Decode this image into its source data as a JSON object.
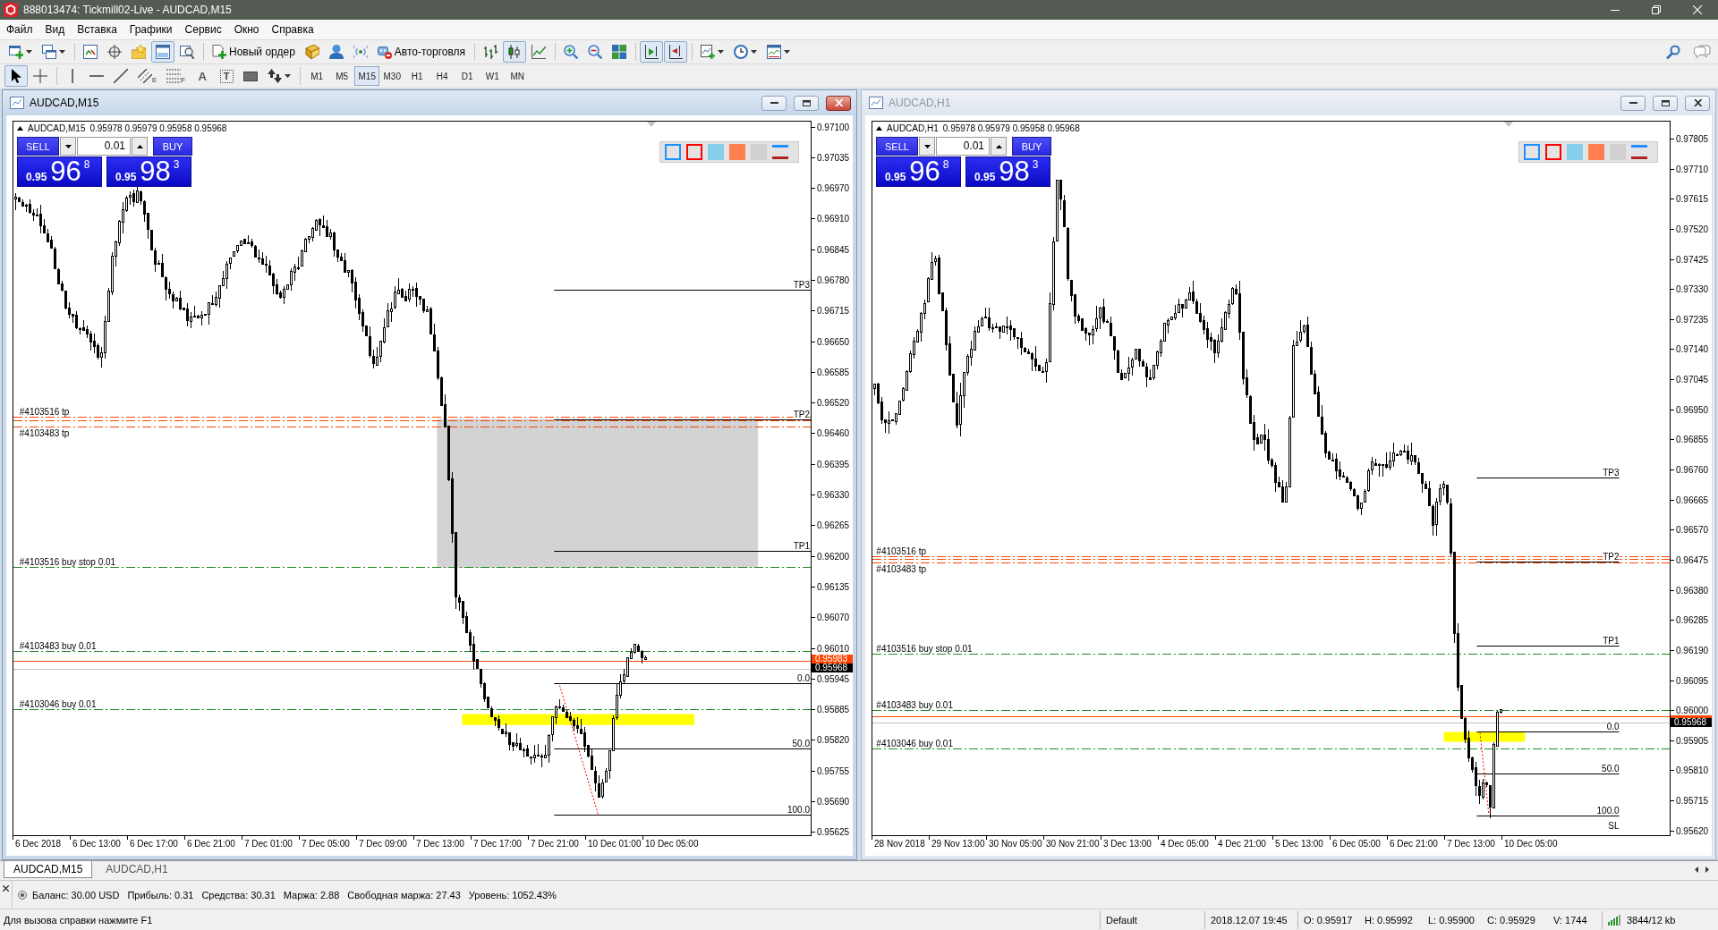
{
  "window": {
    "title": "888013474: Tickmill02-Live - AUDCAD,M15"
  },
  "menu": [
    "Файл",
    "Вид",
    "Вставка",
    "Графики",
    "Сервис",
    "Окно",
    "Справка"
  ],
  "toolbar": [
    [
      {
        "kind": "menu",
        "pressed": false
      },
      {
        "kind": "menu",
        "pressed": false
      }
    ],
    [
      {
        "kind": "icon",
        "pressed": false
      },
      {
        "kind": "icon",
        "pressed": false
      },
      {
        "kind": "icon",
        "pressed": false
      },
      {
        "kind": "icon",
        "pressed": true
      },
      {
        "kind": "icon",
        "pressed": false
      }
    ],
    [
      {
        "kind": "icontext",
        "label": "Новый ордер",
        "pressed": false
      },
      {
        "kind": "icon",
        "pressed": false
      },
      {
        "kind": "icon",
        "pressed": false
      },
      {
        "kind": "icon",
        "pressed": false
      },
      {
        "kind": "icontext",
        "label": "Авто-торговля",
        "pressed": false
      }
    ],
    [
      {
        "kind": "icon",
        "pressed": false
      },
      {
        "kind": "icon",
        "pressed": true
      },
      {
        "kind": "icon",
        "pressed": false
      }
    ],
    [
      {
        "kind": "icon",
        "pressed": false
      },
      {
        "kind": "icon",
        "pressed": false
      },
      {
        "kind": "icon",
        "pressed": false
      }
    ],
    [
      {
        "kind": "icon",
        "pressed": true
      },
      {
        "kind": "icon",
        "pressed": true
      }
    ],
    [
      {
        "kind": "menu",
        "pressed": false
      },
      {
        "kind": "menu",
        "pressed": false
      },
      {
        "kind": "menu",
        "pressed": false
      }
    ]
  ],
  "drawing_tools": [
    [
      {
        "kind": "icon",
        "pressed": true
      },
      {
        "kind": "icon",
        "pressed": false
      }
    ],
    [
      {
        "kind": "icon",
        "pressed": false
      },
      {
        "kind": "icon",
        "pressed": false
      },
      {
        "kind": "icon",
        "pressed": false
      },
      {
        "kind": "icon",
        "pressed": false,
        "sub": "E"
      },
      {
        "kind": "icon",
        "pressed": false,
        "sub": "F"
      },
      {
        "kind": "text",
        "label": "A",
        "pressed": false
      },
      {
        "kind": "framed",
        "label": "T",
        "pressed": false
      },
      {
        "kind": "icon",
        "pressed": false
      },
      {
        "kind": "menu",
        "pressed": false
      }
    ]
  ],
  "timeframes": [
    {
      "label": "M1",
      "selected": false
    },
    {
      "label": "M5",
      "selected": false
    },
    {
      "label": "M15",
      "selected": true
    },
    {
      "label": "M30",
      "selected": false
    },
    {
      "label": "H1",
      "selected": false
    },
    {
      "label": "H4",
      "selected": false
    },
    {
      "label": "D1",
      "selected": false
    },
    {
      "label": "W1",
      "selected": false
    },
    {
      "label": "MN",
      "selected": false
    }
  ],
  "charts": [
    {
      "title": "AUDCAD,M15",
      "active": true,
      "symbol": "AUDCAD,M15",
      "quote": "0.95978 0.95979 0.95958 0.95968",
      "trade_panel": {
        "sell": "SELL",
        "buy": "BUY",
        "lot": "0.01",
        "bid": {
          "prefix": "0.95",
          "big": "96",
          "sup": "8"
        },
        "ask": {
          "prefix": "0.95",
          "big": "98",
          "sup": "3"
        }
      },
      "order_lines": [
        {
          "kind": "tp",
          "label": "#4103516 tp"
        },
        {
          "kind": "tp",
          "label": "#4103483 tp"
        },
        {
          "kind": "order",
          "label": "#4103516 buy stop 0.01"
        },
        {
          "kind": "order",
          "label": "#4103483 buy 0.01"
        },
        {
          "kind": "order",
          "label": "#4103046 buy 0.01"
        }
      ],
      "targets": [
        "TP3",
        "TP2",
        "TP1"
      ],
      "fibo": [
        "0.0",
        "50.0",
        "100.0"
      ],
      "price_axis": [
        "0.97100",
        "0.97035",
        "0.96970",
        "0.96910",
        "0.96845",
        "0.96780",
        "0.96715",
        "0.96650",
        "0.96585",
        "0.96520",
        "0.96460",
        "0.96395",
        "0.96330",
        "0.96265",
        "0.96200",
        "0.96135",
        "0.96070",
        "0.96010",
        "0.95945",
        "0.95885",
        "0.95820",
        "0.95755",
        "0.95690",
        "0.95625"
      ],
      "price_tags": [
        {
          "kind": "ask",
          "label": "0.95983"
        },
        {
          "kind": "bid",
          "label": "0.95968"
        }
      ],
      "time_axis": [
        "6 Dec 2018",
        "6 Dec 13:00",
        "6 Dec 17:00",
        "6 Dec 21:00",
        "7 Dec 01:00",
        "7 Dec 05:00",
        "7 Dec 09:00",
        "7 Dec 13:00",
        "7 Dec 17:00",
        "7 Dec 21:00",
        "10 Dec 01:00",
        "10 Dec 05:00"
      ]
    },
    {
      "title": "AUDCAD,H1",
      "active": false,
      "symbol": "AUDCAD,H1",
      "quote": "0.95978 0.95979 0.95958 0.95968",
      "trade_panel": {
        "sell": "SELL",
        "buy": "BUY",
        "lot": "0.01",
        "bid": {
          "prefix": "0.95",
          "big": "96",
          "sup": "8"
        },
        "ask": {
          "prefix": "0.95",
          "big": "98",
          "sup": "3"
        }
      },
      "order_lines": [
        {
          "kind": "tp",
          "label": "#4103516 tp"
        },
        {
          "kind": "tp",
          "label": "#4103483 tp"
        },
        {
          "kind": "order",
          "label": "#4103516 buy stop 0.01"
        },
        {
          "kind": "order",
          "label": "#4103483 buy 0.01"
        },
        {
          "kind": "order",
          "label": "#4103046 buy 0.01"
        }
      ],
      "targets": [
        "TP3",
        "TP2",
        "TP1"
      ],
      "fibo": [
        "0.0",
        "50.0",
        "100.0",
        "SL"
      ],
      "price_axis": [
        "0.97805",
        "0.97710",
        "0.97615",
        "0.97520",
        "0.97425",
        "0.97330",
        "0.97235",
        "0.97140",
        "0.97045",
        "0.96950",
        "0.96855",
        "0.96760",
        "0.96665",
        "0.96570",
        "0.96475",
        "0.96380",
        "0.96285",
        "0.96190",
        "0.96095",
        "0.96000",
        "0.95905",
        "0.95810",
        "0.95715",
        "0.95620"
      ],
      "price_tags": [
        {
          "kind": "ask"
        },
        {
          "kind": "bid",
          "label": "0.95968"
        }
      ],
      "time_axis": [
        "28 Nov 2018",
        "29 Nov 13:00",
        "30 Nov 05:00",
        "30 Nov 21:00",
        "3 Dec 13:00",
        "4 Dec 05:00",
        "4 Dec 21:00",
        "5 Dec 13:00",
        "6 Dec 05:00",
        "6 Dec 21:00",
        "7 Dec 13:00",
        "10 Dec 05:00"
      ]
    }
  ],
  "tabs": [
    {
      "label": "AUDCAD,M15",
      "selected": true
    },
    {
      "label": "AUDCAD,H1",
      "selected": false
    }
  ],
  "terminal": {
    "summary": [
      "Баланс: 30.00 USD",
      "Прибыль: 0.31",
      "Средства: 30.31",
      "Маржа: 2.88",
      "Свободная маржа: 27.43",
      "Уровень: 1052.43%"
    ]
  },
  "status_bar": {
    "hint": "Для вызова справки нажмите F1",
    "fields": [
      "Default",
      "2018.12.07 19:45",
      "O: 0.95917",
      "H: 0.95992",
      "L: 0.95900",
      "C: 0.95929",
      "V: 1744"
    ],
    "traffic": "3844/12 kb"
  }
}
